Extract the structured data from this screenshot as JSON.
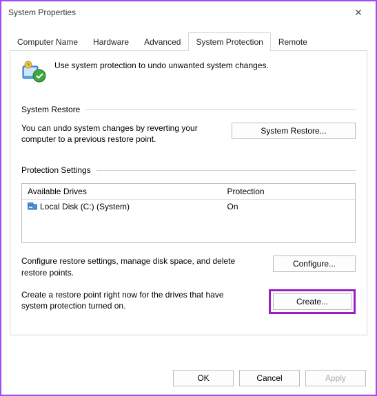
{
  "window": {
    "title": "System Properties"
  },
  "tabs": [
    "Computer Name",
    "Hardware",
    "Advanced",
    "System Protection",
    "Remote"
  ],
  "active_tab_index": 3,
  "intro_text": "Use system protection to undo unwanted system changes.",
  "sections": {
    "restore": {
      "heading": "System Restore",
      "text": "You can undo system changes by reverting your computer to a previous restore point.",
      "button": "System Restore..."
    },
    "protection": {
      "heading": "Protection Settings",
      "columns": {
        "drives": "Available Drives",
        "protection": "Protection"
      },
      "rows": [
        {
          "name": "Local Disk (C:) (System)",
          "status": "On"
        }
      ],
      "configure_text": "Configure restore settings, manage disk space, and delete restore points.",
      "configure_button": "Configure...",
      "create_text": "Create a restore point right now for the drives that have system protection turned on.",
      "create_button": "Create..."
    }
  },
  "footer": {
    "ok": "OK",
    "cancel": "Cancel",
    "apply": "Apply"
  }
}
